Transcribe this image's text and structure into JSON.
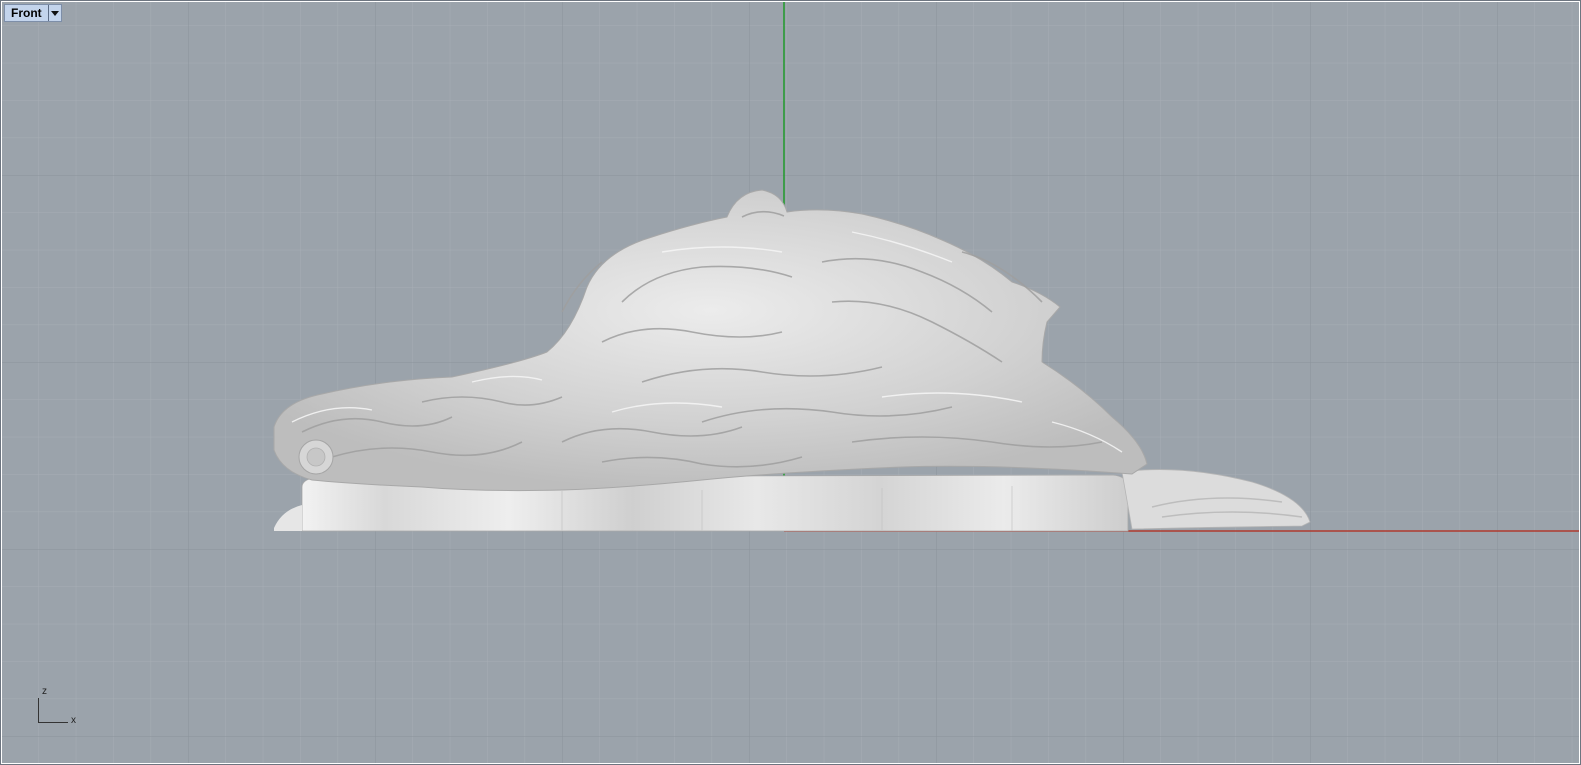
{
  "viewport": {
    "name": "Front",
    "view_menu_icon": "chevron-down-icon",
    "background_color": "#9ba3ab",
    "grid_minor_color": "#a6adb4",
    "grid_major_color": "#8d959d",
    "x_axis_color": "#b03a2e",
    "z_axis_color": "#1f9a2a",
    "model_color": "#d9d9d9"
  },
  "axis_indicator": {
    "vertical_label": "z",
    "horizontal_label": "x"
  }
}
